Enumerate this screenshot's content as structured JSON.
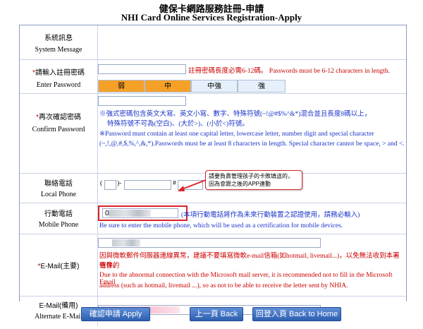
{
  "header": {
    "title_zh": "健保卡網路服務註冊-申請",
    "title_en": "NHI Card Online Services Registration-Apply"
  },
  "system_message": {
    "label_zh": "系統訊息",
    "label_en": "System Message"
  },
  "password": {
    "required_mark": "*",
    "label_zh": "請輸入註冊密碼",
    "label_en": "Enter Password",
    "hint": "註冊密碼長度必需6-12碼。 Passwords must be 6-12 characters in length.",
    "strength": [
      "弱",
      "中",
      "中強",
      "強"
    ]
  },
  "confirm_password": {
    "required_mark": "*",
    "label_zh": "再次確認密碼",
    "label_en": "Confirm Password",
    "rule_zh_1": "※強式密碼包含英文大寫、英文小寫、數字、特殊符號(~!@#$%^&*)混合並且長度8碼以上，",
    "rule_zh_2": "特殊符號不可為(空白)、(大於>)、(小於<)符號。",
    "rule_en_1": "※Password must contain at least one capital letter, lowercase letter, number digit and special character",
    "rule_en_2": "(~,!,@,#,$,%,^,&,*).Passwords must be at least 8 characters in length. Special character cannot be space, > and <."
  },
  "local_phone": {
    "label_zh": "聯絡電話",
    "label_en": "Local Phone",
    "open_paren": "(",
    "close_paren": ")-",
    "ext_sep": "#"
  },
  "mobile_phone": {
    "label_zh": "行動電話",
    "label_en": "Mobile Phone",
    "prefix": "09",
    "hint_zh": "(本項行動電話將作為未來行動裝置之認證使用，請務必輸入)",
    "hint_en": "Be sure to enter the mobile phone, which will be used as a certification for mobile devices.",
    "callout_1": "請要負責管理孩子的卡敗填這的，",
    "callout_2": "因為會跟之後的APP連動"
  },
  "email": {
    "required_mark": "*",
    "label_zh": "E-Mail(主要)",
    "warn_zh_1": "因與微軟郵件伺服器連線異常，建議不要填寫微軟e-mail信箱(如hotmail, livemail...)，以免無法收到本署寄發的",
    "warn_zh_2": "信件。",
    "warn_en_1": "Due to the abnormal connection with the Microsoft mail server, it is recommended not to fill in the Microsoft Email",
    "warn_en_2": "address (such as hotmail, livemail ...), so as not to be able to receive the letter sent by NHIA."
  },
  "alt_email": {
    "label_zh": "E-Mail(備用)",
    "label_en": "Alternate E-Mail"
  },
  "buttons": {
    "apply": "確認申請 Apply",
    "back": "上一頁 Back",
    "home": "回登入頁 Back to Home"
  },
  "colors": {
    "required": "#cc0000",
    "hint_blue": "#1a34c8",
    "strength_active": "#f5a128",
    "strength_inactive": "#e6f0fb",
    "button": "#2d5fb0",
    "callout_border": "#d9232a"
  }
}
